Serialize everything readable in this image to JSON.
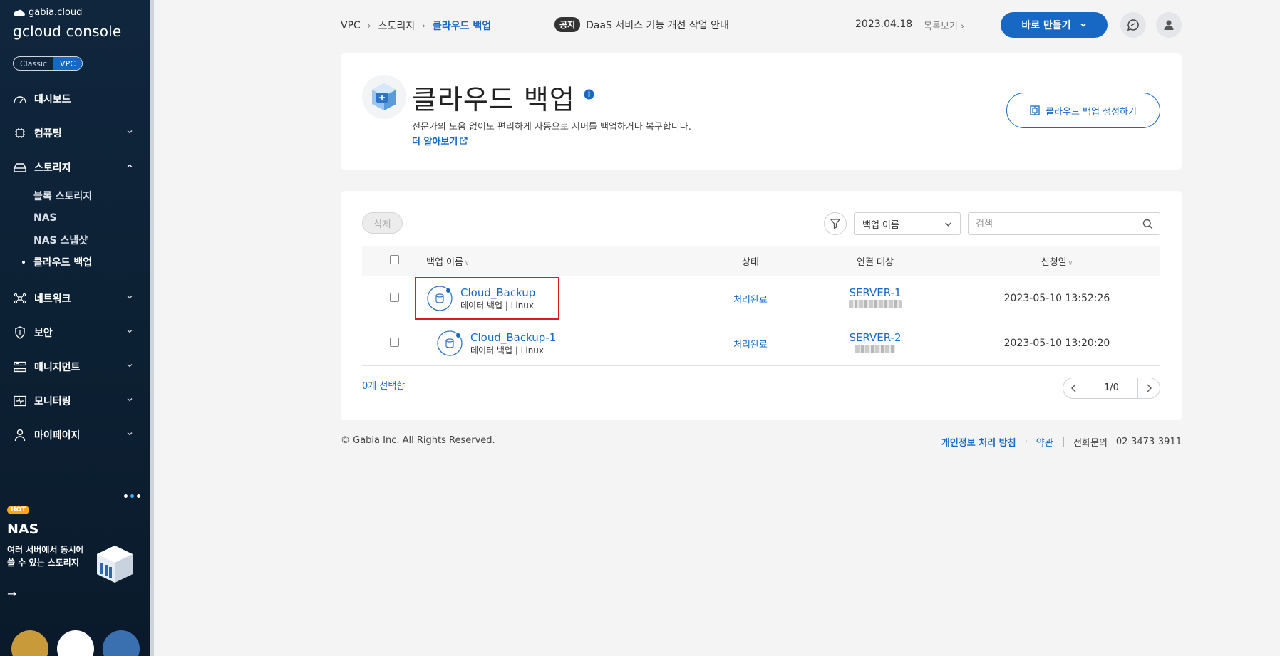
{
  "sidebar": {
    "brand_small": "gabia.cloud",
    "brand_big": "gcloud console",
    "mode_classic": "Classic",
    "mode_vpc": "VPC",
    "items": [
      {
        "label": "대시보드",
        "icon": "dashboard-icon"
      },
      {
        "label": "컴퓨팅",
        "icon": "chip-icon"
      },
      {
        "label": "스토리지",
        "icon": "storage-icon"
      },
      {
        "label": "네트워크",
        "icon": "network-icon"
      },
      {
        "label": "보안",
        "icon": "shield-icon"
      },
      {
        "label": "매니지먼트",
        "icon": "management-icon"
      },
      {
        "label": "모니터링",
        "icon": "monitor-icon"
      },
      {
        "label": "마이페이지",
        "icon": "user-icon"
      }
    ],
    "storage_sub": [
      {
        "label": "블록 스토리지"
      },
      {
        "label": "NAS"
      },
      {
        "label": "NAS 스냅샷"
      },
      {
        "label": "클라우드 백업"
      }
    ],
    "promo": {
      "badge": "HOT",
      "title": "NAS",
      "desc": "여러 서버에서 동시에 쓸 수 있는 스토리지",
      "arrow": "→"
    }
  },
  "topbar": {
    "breadcrumb": [
      "VPC",
      "스토리지",
      "클라우드 백업"
    ],
    "notice_tag": "공지",
    "notice_text": "DaaS 서비스 기능 개선 작업 안내",
    "notice_date": "2023.04.18",
    "notice_more": "목록보기",
    "create_label": "바로 만들기"
  },
  "header": {
    "title": "클라우드 백업",
    "desc": "전문가의 도움 없이도 편리하게 자동으로 서버를 백업하거나 복구합니다.",
    "learn_more": "더 알아보기",
    "make_backup": "클라우드 백업 생성하기"
  },
  "toolbar": {
    "delete_label": "삭제",
    "select_value": "백업 이름",
    "search_placeholder": "검색"
  },
  "table": {
    "headers": {
      "name": "백업 이름",
      "status": "상태",
      "target": "연결 대상",
      "date": "신청일"
    },
    "rows": [
      {
        "name": "Cloud_Backup",
        "sub": "데이터 백업 | Linux",
        "status": "처리완료",
        "target": "SERVER-1",
        "date": "2023-05-10 13:52:26"
      },
      {
        "name": "Cloud_Backup-1",
        "sub": "데이터 백업 | Linux",
        "status": "처리완료",
        "target": "SERVER-2",
        "date": "2023-05-10 13:20:20"
      }
    ],
    "selected_count": "0개 선택함",
    "pager": "1/0"
  },
  "footer": {
    "copyright": "© Gabia Inc. All Rights Reserved.",
    "privacy": "개인정보 처리 방침",
    "terms": "약관",
    "phone_label": "전화문의",
    "phone": "02-3473-3911"
  },
  "colors": {
    "accent": "#1668c4",
    "sidebar_bg": "#0f2438",
    "highlight": "#e0191f",
    "hot": "#f7a614"
  }
}
